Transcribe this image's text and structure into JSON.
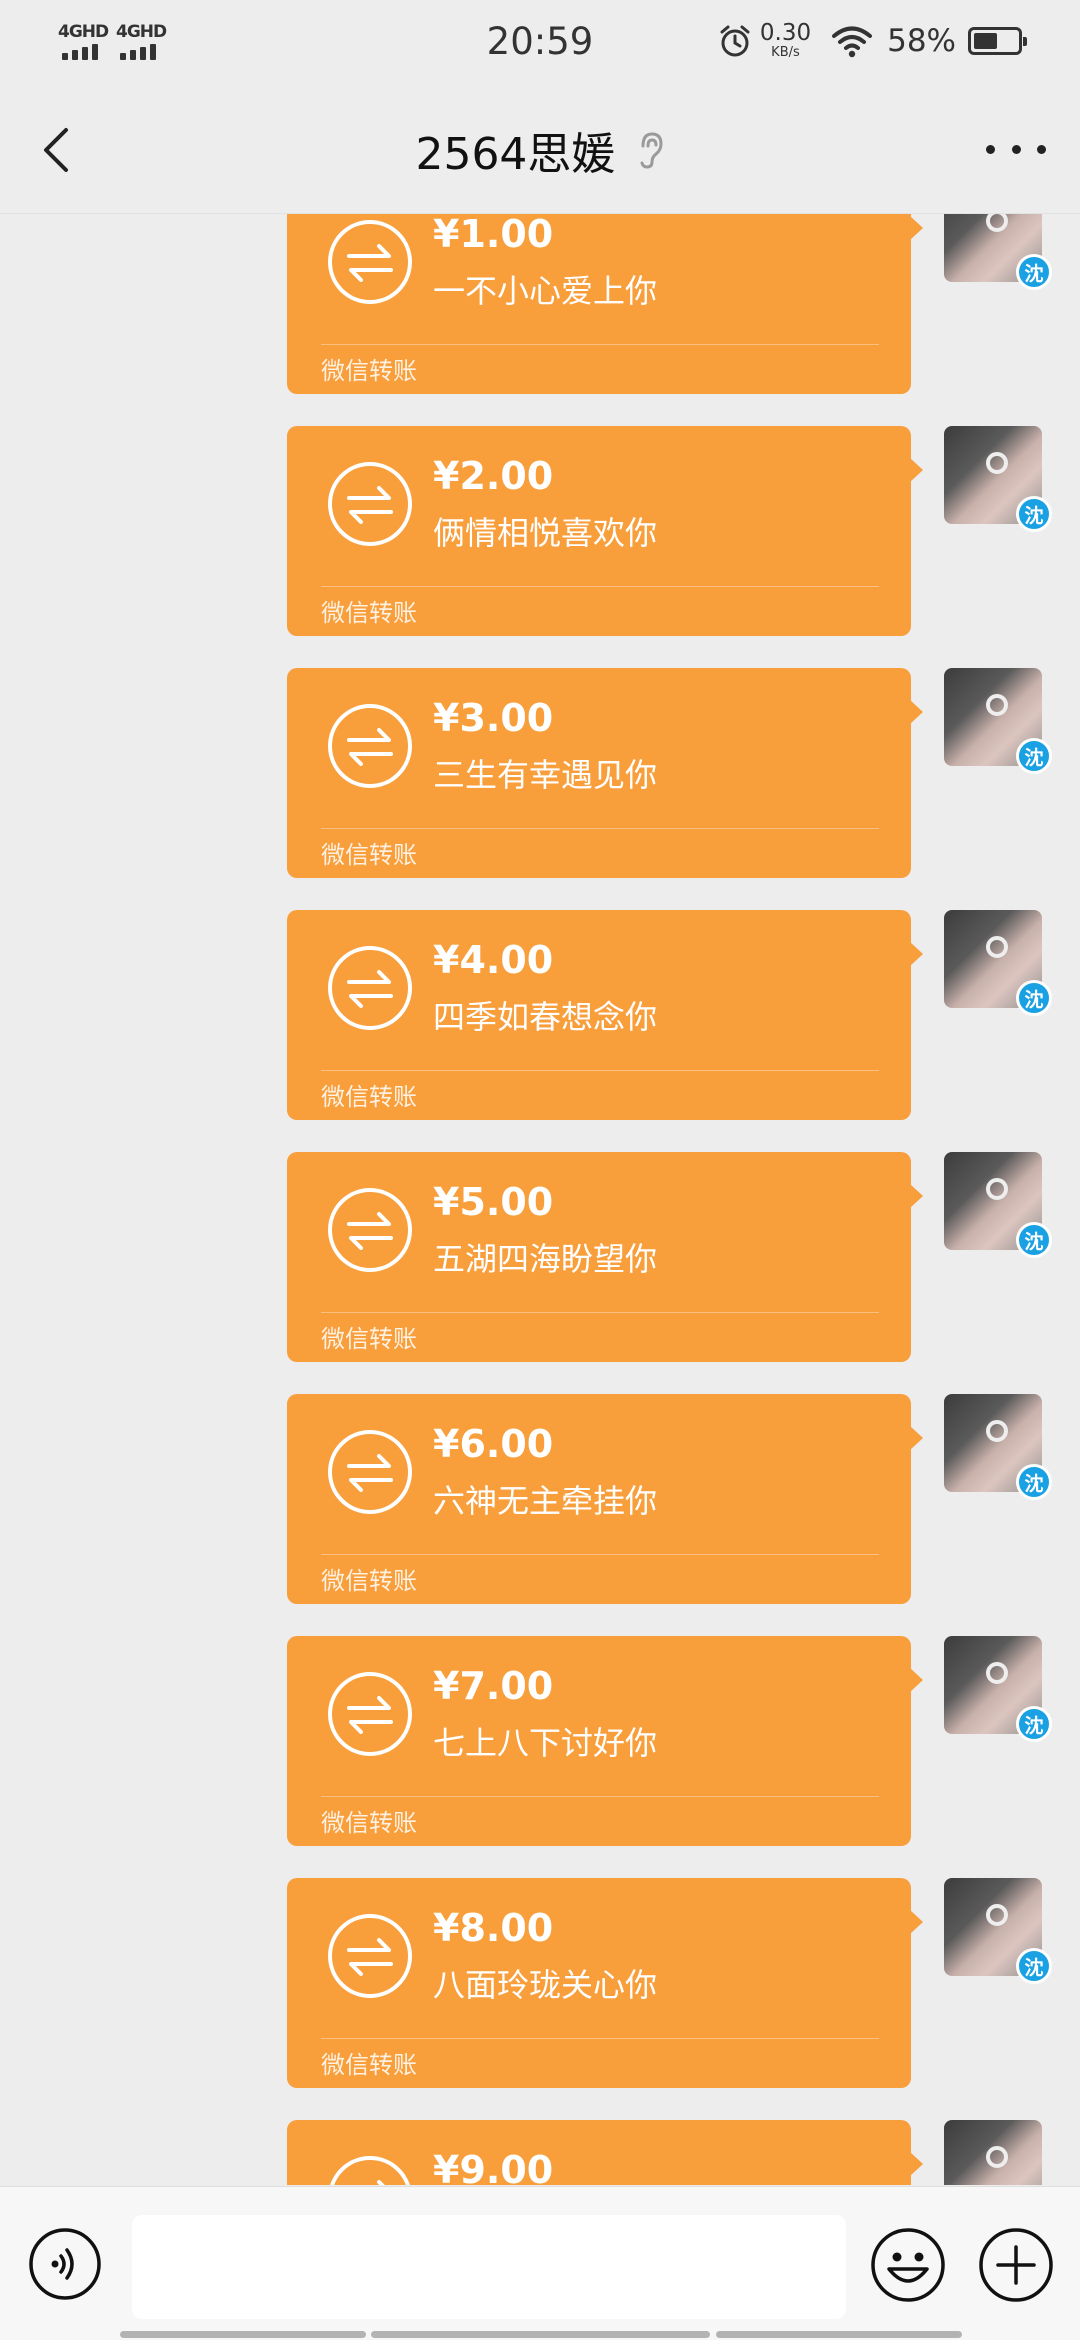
{
  "status_bar": {
    "network1": "4GHD",
    "network2": "4GHD",
    "time": "20:59",
    "speed_value": "0.30",
    "speed_unit": "KB/s",
    "battery": "58%",
    "battery_level": 0.55
  },
  "header": {
    "title": "2564思媛"
  },
  "messages": [
    {
      "amount": "¥1.00",
      "note": "一不小心爱上你",
      "source": "微信转账",
      "avatar_badge": "沈"
    },
    {
      "amount": "¥2.00",
      "note": "俩情相悦喜欢你",
      "source": "微信转账",
      "avatar_badge": "沈"
    },
    {
      "amount": "¥3.00",
      "note": "三生有幸遇见你",
      "source": "微信转账",
      "avatar_badge": "沈"
    },
    {
      "amount": "¥4.00",
      "note": "四季如春想念你",
      "source": "微信转账",
      "avatar_badge": "沈"
    },
    {
      "amount": "¥5.00",
      "note": "五湖四海盼望你",
      "source": "微信转账",
      "avatar_badge": "沈"
    },
    {
      "amount": "¥6.00",
      "note": "六神无主牵挂你",
      "source": "微信转账",
      "avatar_badge": "沈"
    },
    {
      "amount": "¥7.00",
      "note": "七上八下讨好你",
      "source": "微信转账",
      "avatar_badge": "沈"
    },
    {
      "amount": "¥8.00",
      "note": "八面玲珑关心你",
      "source": "微信转账",
      "avatar_badge": "沈"
    },
    {
      "amount": "¥9.00",
      "note": "",
      "source": "",
      "avatar_badge": ""
    }
  ],
  "input_bar": {
    "placeholder": ""
  },
  "colors": {
    "transfer_bubble": "#f89e3b",
    "badge": "#1aa1e3",
    "background": "#ededed"
  }
}
